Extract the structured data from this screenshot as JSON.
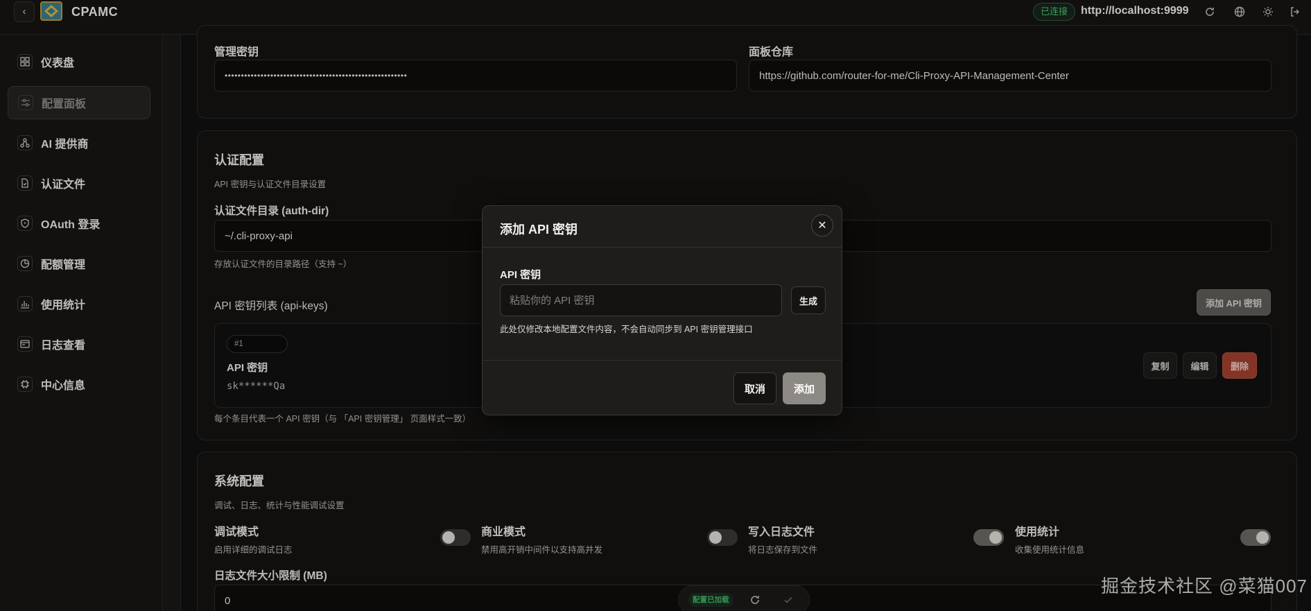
{
  "app": {
    "brand": "CPAMC",
    "status_badge": "已连接",
    "server_url": "http://localhost:9999"
  },
  "sidebar": {
    "items": [
      {
        "label": "仪表盘",
        "icon": "dashboard-icon"
      },
      {
        "label": "配置面板",
        "icon": "sliders-icon",
        "active": true
      },
      {
        "label": "AI 提供商",
        "icon": "network-icon"
      },
      {
        "label": "认证文件",
        "icon": "file-icon"
      },
      {
        "label": "OAuth 登录",
        "icon": "shield-icon"
      },
      {
        "label": "配额管理",
        "icon": "pie-icon"
      },
      {
        "label": "使用统计",
        "icon": "bar-chart-icon"
      },
      {
        "label": "日志查看",
        "icon": "terminal-icon"
      },
      {
        "label": "中心信息",
        "icon": "cpu-icon"
      }
    ]
  },
  "general": {
    "mgmt_key_label": "管理密钥",
    "mgmt_key_value": "••••••••••••••••••••••••••••••••••••••••••••••••••••••••",
    "repo_label": "面板仓库",
    "repo_value": "https://github.com/router-for-me/Cli-Proxy-API-Management-Center"
  },
  "auth": {
    "title": "认证配置",
    "desc": "API 密钥与认证文件目录设置",
    "dir_label": "认证文件目录 (auth-dir)",
    "dir_value": "~/.cli-proxy-api",
    "dir_hint": "存放认证文件的目录路径（支持 ~）",
    "keys_label": "API 密钥列表 (api-keys)",
    "add_key_button": "添加 API 密钥",
    "key_item": {
      "index": "#1",
      "name": "API 密钥",
      "masked": "sk******Qa",
      "copy": "复制",
      "edit": "编辑",
      "delete": "删除"
    },
    "keys_hint": "每个条目代表一个 API 密钥（与 「API 密钥管理」 页面样式一致）"
  },
  "system": {
    "title": "系统配置",
    "desc": "调试、日志、统计与性能调试设置",
    "toggles": [
      {
        "label": "调试模式",
        "desc": "启用详细的调试日志",
        "on": false
      },
      {
        "label": "商业模式",
        "desc": "禁用高开销中间件以支持高并发",
        "on": false
      },
      {
        "label": "写入日志文件",
        "desc": "将日志保存到文件",
        "on": true
      },
      {
        "label": "使用统计",
        "desc": "收集使用统计信息",
        "on": true
      }
    ],
    "log_size_label": "日志文件大小限制 (MB)",
    "log_size_value": "0"
  },
  "modal": {
    "title": "添加 API 密钥",
    "field_label": "API 密钥",
    "placeholder": "粘贴你的 API 密钥",
    "generate": "生成",
    "hint": "此处仅修改本地配置文件内容，不会自动同步到 API 密钥管理接口",
    "cancel": "取消",
    "add": "添加"
  },
  "float_bar": {
    "badge": "配置已加载"
  },
  "watermark": "掘金技术社区 @菜猫007",
  "colors": {
    "danger": "#a0402f",
    "success": "#4fbf73",
    "muted_button": "#8d8984"
  }
}
